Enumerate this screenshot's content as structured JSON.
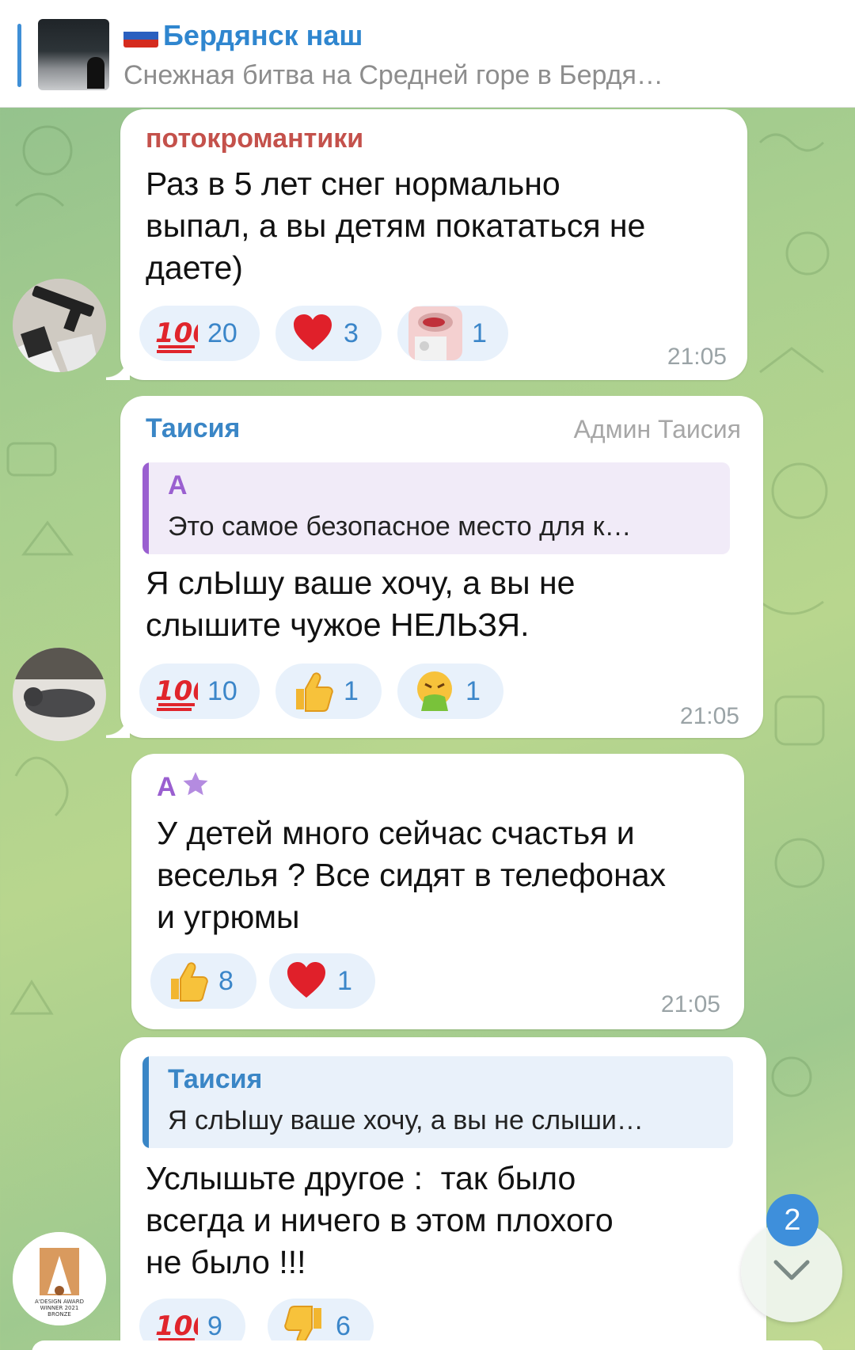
{
  "pinned": {
    "channel_title": "Бердянск наш",
    "preview_text": "Снежная битва на Средней горе в Бердя…"
  },
  "colors": {
    "accent": "#3f8fd6",
    "reaction_bg": "#e8f1fb",
    "reaction_count": "#3b86c9",
    "sender_red": "#c4514b",
    "sender_blue": "#3a86c6",
    "sender_purple": "#9a5fd0"
  },
  "messages": [
    {
      "sender": "потокромантики",
      "text_lines": [
        "Раз в 5 лет снег нормально",
        "выпал, а вы детям покататься не",
        "даете)"
      ],
      "reactions": [
        {
          "icon": "hundred-points-icon",
          "count": "20"
        },
        {
          "icon": "red-heart-icon",
          "count": "3"
        },
        {
          "icon": "sticker-face-icon",
          "count": "1"
        }
      ],
      "time": "21:05"
    },
    {
      "sender": "Таисия",
      "admin_title": "Админ Таисия",
      "reply": {
        "name": "А",
        "text": "Это самое безопасное место для к…"
      },
      "text_lines": [
        "Я слЫшу ваше хочу, а вы не",
        "слышите чужое НЕЛЬЗЯ."
      ],
      "reactions": [
        {
          "icon": "hundred-points-icon",
          "count": "10"
        },
        {
          "icon": "thumbs-up-icon",
          "count": "1"
        },
        {
          "icon": "vomiting-face-icon",
          "count": "1"
        }
      ],
      "time": "21:05"
    },
    {
      "sender": "А",
      "sender_icon": "star-icon",
      "text_lines": [
        "У детей много сейчас счастья и",
        "веселья ? Все сидят в телефонах",
        "и угрюмы"
      ],
      "reactions": [
        {
          "icon": "thumbs-up-icon",
          "count": "8"
        },
        {
          "icon": "red-heart-icon",
          "count": "1"
        }
      ],
      "time": "21:05"
    },
    {
      "reply": {
        "name": "Таисия",
        "text": "Я слЫшу ваше хочу, а вы не слыши…"
      },
      "text_lines": [
        "Услышьте другое :  так было",
        "всегда и ничего в этом плохого",
        "не было !!!"
      ],
      "reactions": [
        {
          "icon": "hundred-points-icon",
          "count": "9"
        },
        {
          "icon": "thumbs-down-icon",
          "count": "6"
        }
      ]
    }
  ],
  "scroll_down": {
    "unread_count": "2",
    "icon": "chevron-down-icon"
  },
  "avatar4": {
    "award_line1": "A'DESIGN AWARD",
    "award_line2": "WINNER 2021",
    "award_line3": "BRONZE"
  }
}
